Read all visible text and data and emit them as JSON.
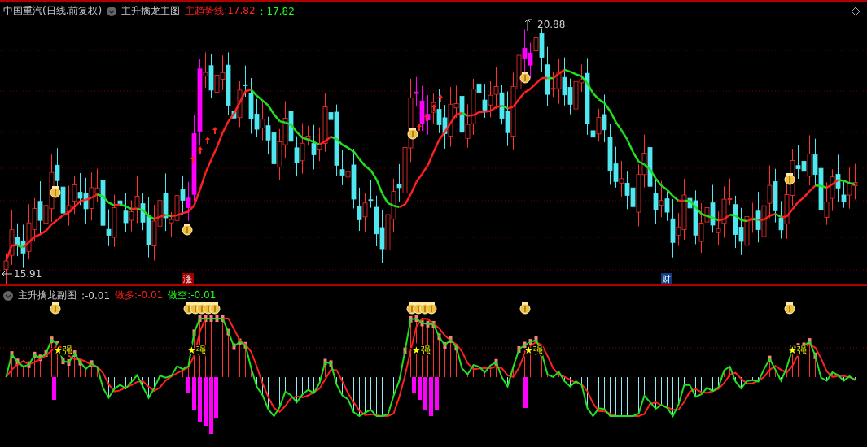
{
  "main_chart": {
    "stock": "中国重汽(日线.前复权)",
    "indicator": "主升擒龙主图",
    "trend": {
      "label": "主趋势线:",
      "value": "17.82"
    },
    "trend_value_2": ": 17.82",
    "high_label": "20.88",
    "low_label": "15.91",
    "events": [
      {
        "text": "涨",
        "kind": "rise"
      },
      {
        "text": "财",
        "kind": "finance"
      }
    ]
  },
  "sub_chart": {
    "indicator": "主升擒龙副图",
    "value": ":-0.01",
    "long": {
      "label": "做多:",
      "value": "-0.01"
    },
    "short": {
      "label": "做空:",
      "value": "-0.01"
    },
    "signals": [
      "★强",
      "★强",
      "★强",
      "★强",
      "★强"
    ]
  }
}
